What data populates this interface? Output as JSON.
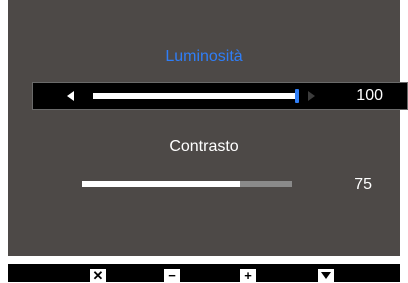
{
  "menu": {
    "title": "Luminosità",
    "brightness": {
      "value": "100",
      "level": 1.0
    },
    "contrast": {
      "label": "Contrasto",
      "value": "75",
      "level": 0.75
    }
  },
  "buttons": {
    "close": "✕",
    "minus": "−",
    "plus": "+",
    "down_icon": "chevron-down-icon"
  },
  "colors": {
    "osd_background": "#4d4947",
    "accent": "#2f7ef7",
    "selected_row": "#000000"
  }
}
